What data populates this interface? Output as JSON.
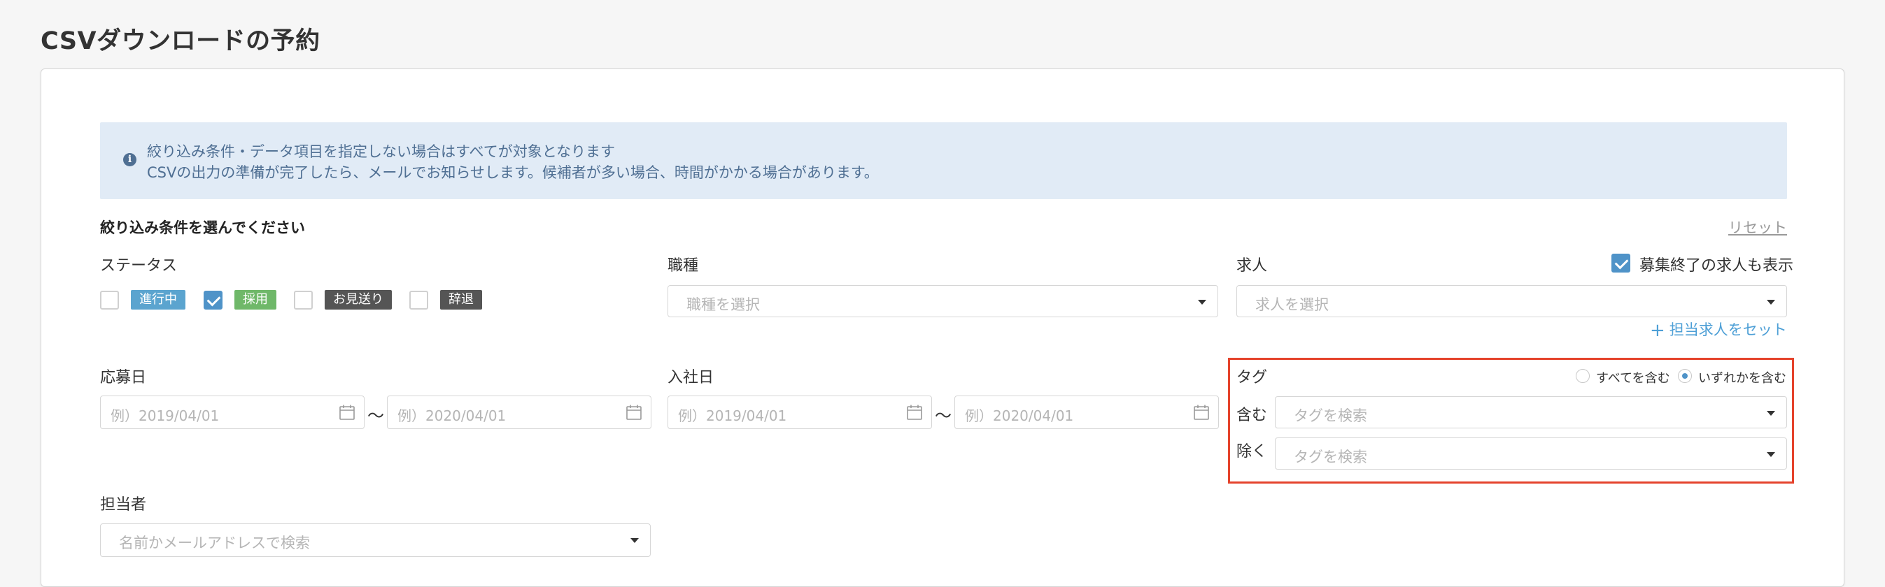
{
  "page": {
    "title": "CSVダウンロードの予約"
  },
  "notice": {
    "icon": "info-icon",
    "line1": "絞り込み条件・データ項目を指定しない場合はすべてが対象となります",
    "line2": "CSVの出力の準備が完了したら、メールでお知らせします。候補者が多い場合、時間がかかる場合があります。"
  },
  "filters": {
    "heading": "絞り込み条件を選んでください",
    "reset_label": "リセット"
  },
  "status": {
    "label": "ステータス",
    "options": [
      {
        "label": "進行中",
        "checked": false,
        "color": "#5ba4cf"
      },
      {
        "label": "採用",
        "checked": true,
        "color": "#6fb869"
      },
      {
        "label": "お見送り",
        "checked": false,
        "color": "#555555"
      },
      {
        "label": "辞退",
        "checked": false,
        "color": "#555555"
      }
    ]
  },
  "job_type": {
    "label": "職種",
    "placeholder": "職種を選択"
  },
  "job": {
    "label": "求人",
    "placeholder": "求人を選択",
    "show_closed_label": "募集終了の求人も表示",
    "show_closed_checked": true,
    "assign_link": "担当求人をセット"
  },
  "applied_date": {
    "label": "応募日",
    "from_placeholder": "例）2019/04/01",
    "to_placeholder": "例）2020/04/01",
    "separator": "〜"
  },
  "joined_date": {
    "label": "入社日",
    "from_placeholder": "例）2019/04/01",
    "to_placeholder": "例）2020/04/01",
    "separator": "〜"
  },
  "tags": {
    "label": "タグ",
    "match_all_label": "すべてを含む",
    "match_any_label": "いずれかを含む",
    "selected_mode": "any",
    "include_label": "含む",
    "include_placeholder": "タグを検索",
    "exclude_label": "除く",
    "exclude_placeholder": "タグを検索"
  },
  "assignee": {
    "label": "担当者",
    "placeholder": "名前かメールアドレスで検索"
  },
  "colors": {
    "accent": "#4f93c8",
    "link": "#4d9fd6",
    "notice_bg": "#e1ebf6",
    "notice_text": "#4f6f93",
    "highlight": "#e5432c"
  }
}
